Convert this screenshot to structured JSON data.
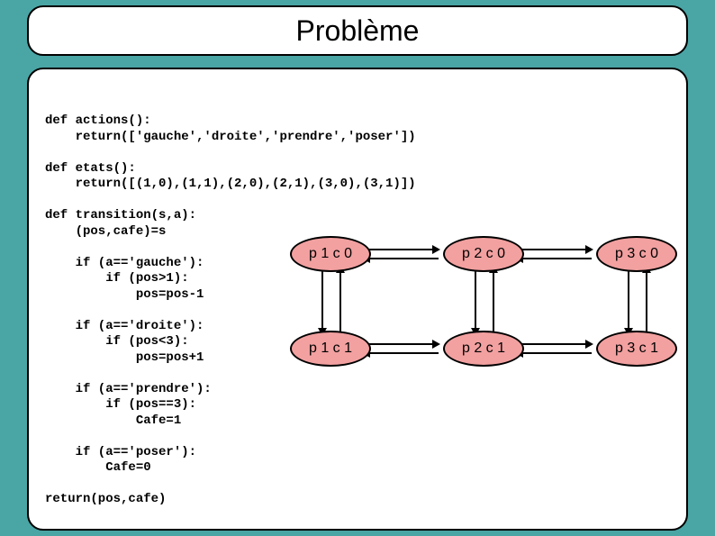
{
  "title": "Problème",
  "code": "def actions():\n    return(['gauche','droite','prendre','poser'])\n\ndef etats():\n    return([(1,0),(1,1),(2,0),(2,1),(3,0),(3,1)])\n\ndef transition(s,a):\n    (pos,cafe)=s\n\n    if (a=='gauche'):\n        if (pos>1):\n            pos=pos-1\n\n    if (a=='droite'):\n        if (pos<3):\n            pos=pos+1\n\n    if (a=='prendre'):\n        if (pos==3):\n            Cafe=1\n\n    if (a=='poser'):\n        Cafe=0\n\nreturn(pos,cafe)",
  "nodes": {
    "n0": "p 1 c 0",
    "n1": "p 2 c 0",
    "n2": "p 3 c 0",
    "n3": "p 1 c 1",
    "n4": "p 2 c 1",
    "n5": "p 3 c 1"
  }
}
